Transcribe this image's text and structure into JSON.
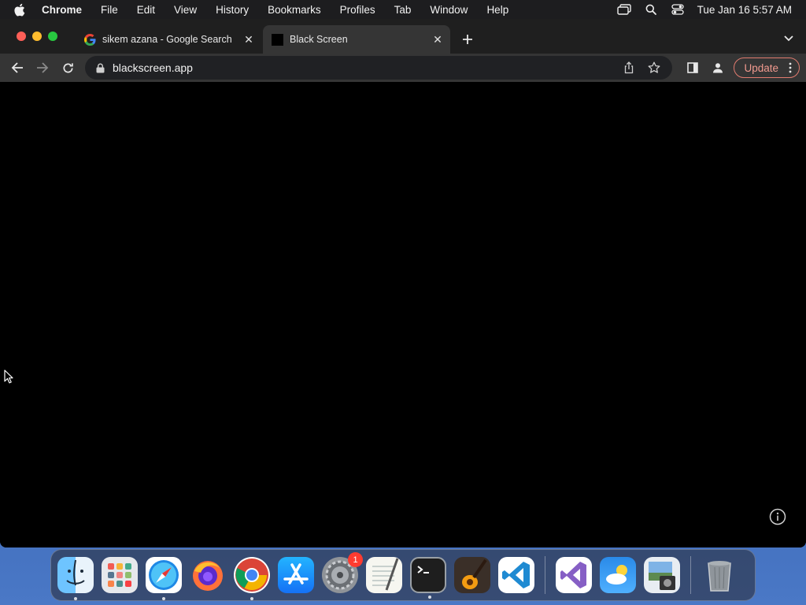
{
  "menubar": {
    "app_name": "Chrome",
    "items": [
      "File",
      "Edit",
      "View",
      "History",
      "Bookmarks",
      "Profiles",
      "Tab",
      "Window",
      "Help"
    ],
    "clock": "Tue Jan 16  5:57 AM"
  },
  "browser": {
    "tabs": [
      {
        "title": "sikem azana - Google Search",
        "favicon": "google-icon",
        "active": false
      },
      {
        "title": "Black Screen",
        "favicon": "black-square-icon",
        "active": true
      }
    ],
    "url": "blackscreen.app",
    "update_label": "Update"
  },
  "dock": {
    "apps": [
      {
        "name": "Finder",
        "icon": "finder-icon",
        "running": true
      },
      {
        "name": "Launchpad",
        "icon": "launchpad-icon",
        "running": false
      },
      {
        "name": "Safari",
        "icon": "safari-icon",
        "running": true
      },
      {
        "name": "Firefox",
        "icon": "firefox-icon",
        "running": false
      },
      {
        "name": "Google Chrome",
        "icon": "chrome-icon",
        "running": true
      },
      {
        "name": "App Store",
        "icon": "app-store-icon",
        "running": false
      },
      {
        "name": "System Settings",
        "icon": "settings-icon",
        "running": false,
        "badge": "1"
      },
      {
        "name": "TextEdit",
        "icon": "textedit-icon",
        "running": false
      },
      {
        "name": "Terminal",
        "icon": "terminal-icon",
        "running": true
      },
      {
        "name": "GarageBand",
        "icon": "garageband-icon",
        "running": false
      },
      {
        "name": "Visual Studio Code",
        "icon": "vscode-icon",
        "running": false
      },
      {
        "name": "Visual Studio",
        "icon": "visual-studio-icon",
        "running": false
      },
      {
        "name": "Weather",
        "icon": "weather-icon",
        "running": false
      },
      {
        "name": "Preview",
        "icon": "preview-icon",
        "running": false
      },
      {
        "name": "Trash",
        "icon": "trash-icon",
        "running": false
      }
    ]
  },
  "colors": {
    "menubar_bg": "#1d1d1f",
    "tabstrip_bg": "#1f1f1f",
    "toolbar_bg": "#353535",
    "page_bg": "#000000",
    "update_accent": "#e07b6f",
    "desktop": "#3561b0"
  }
}
